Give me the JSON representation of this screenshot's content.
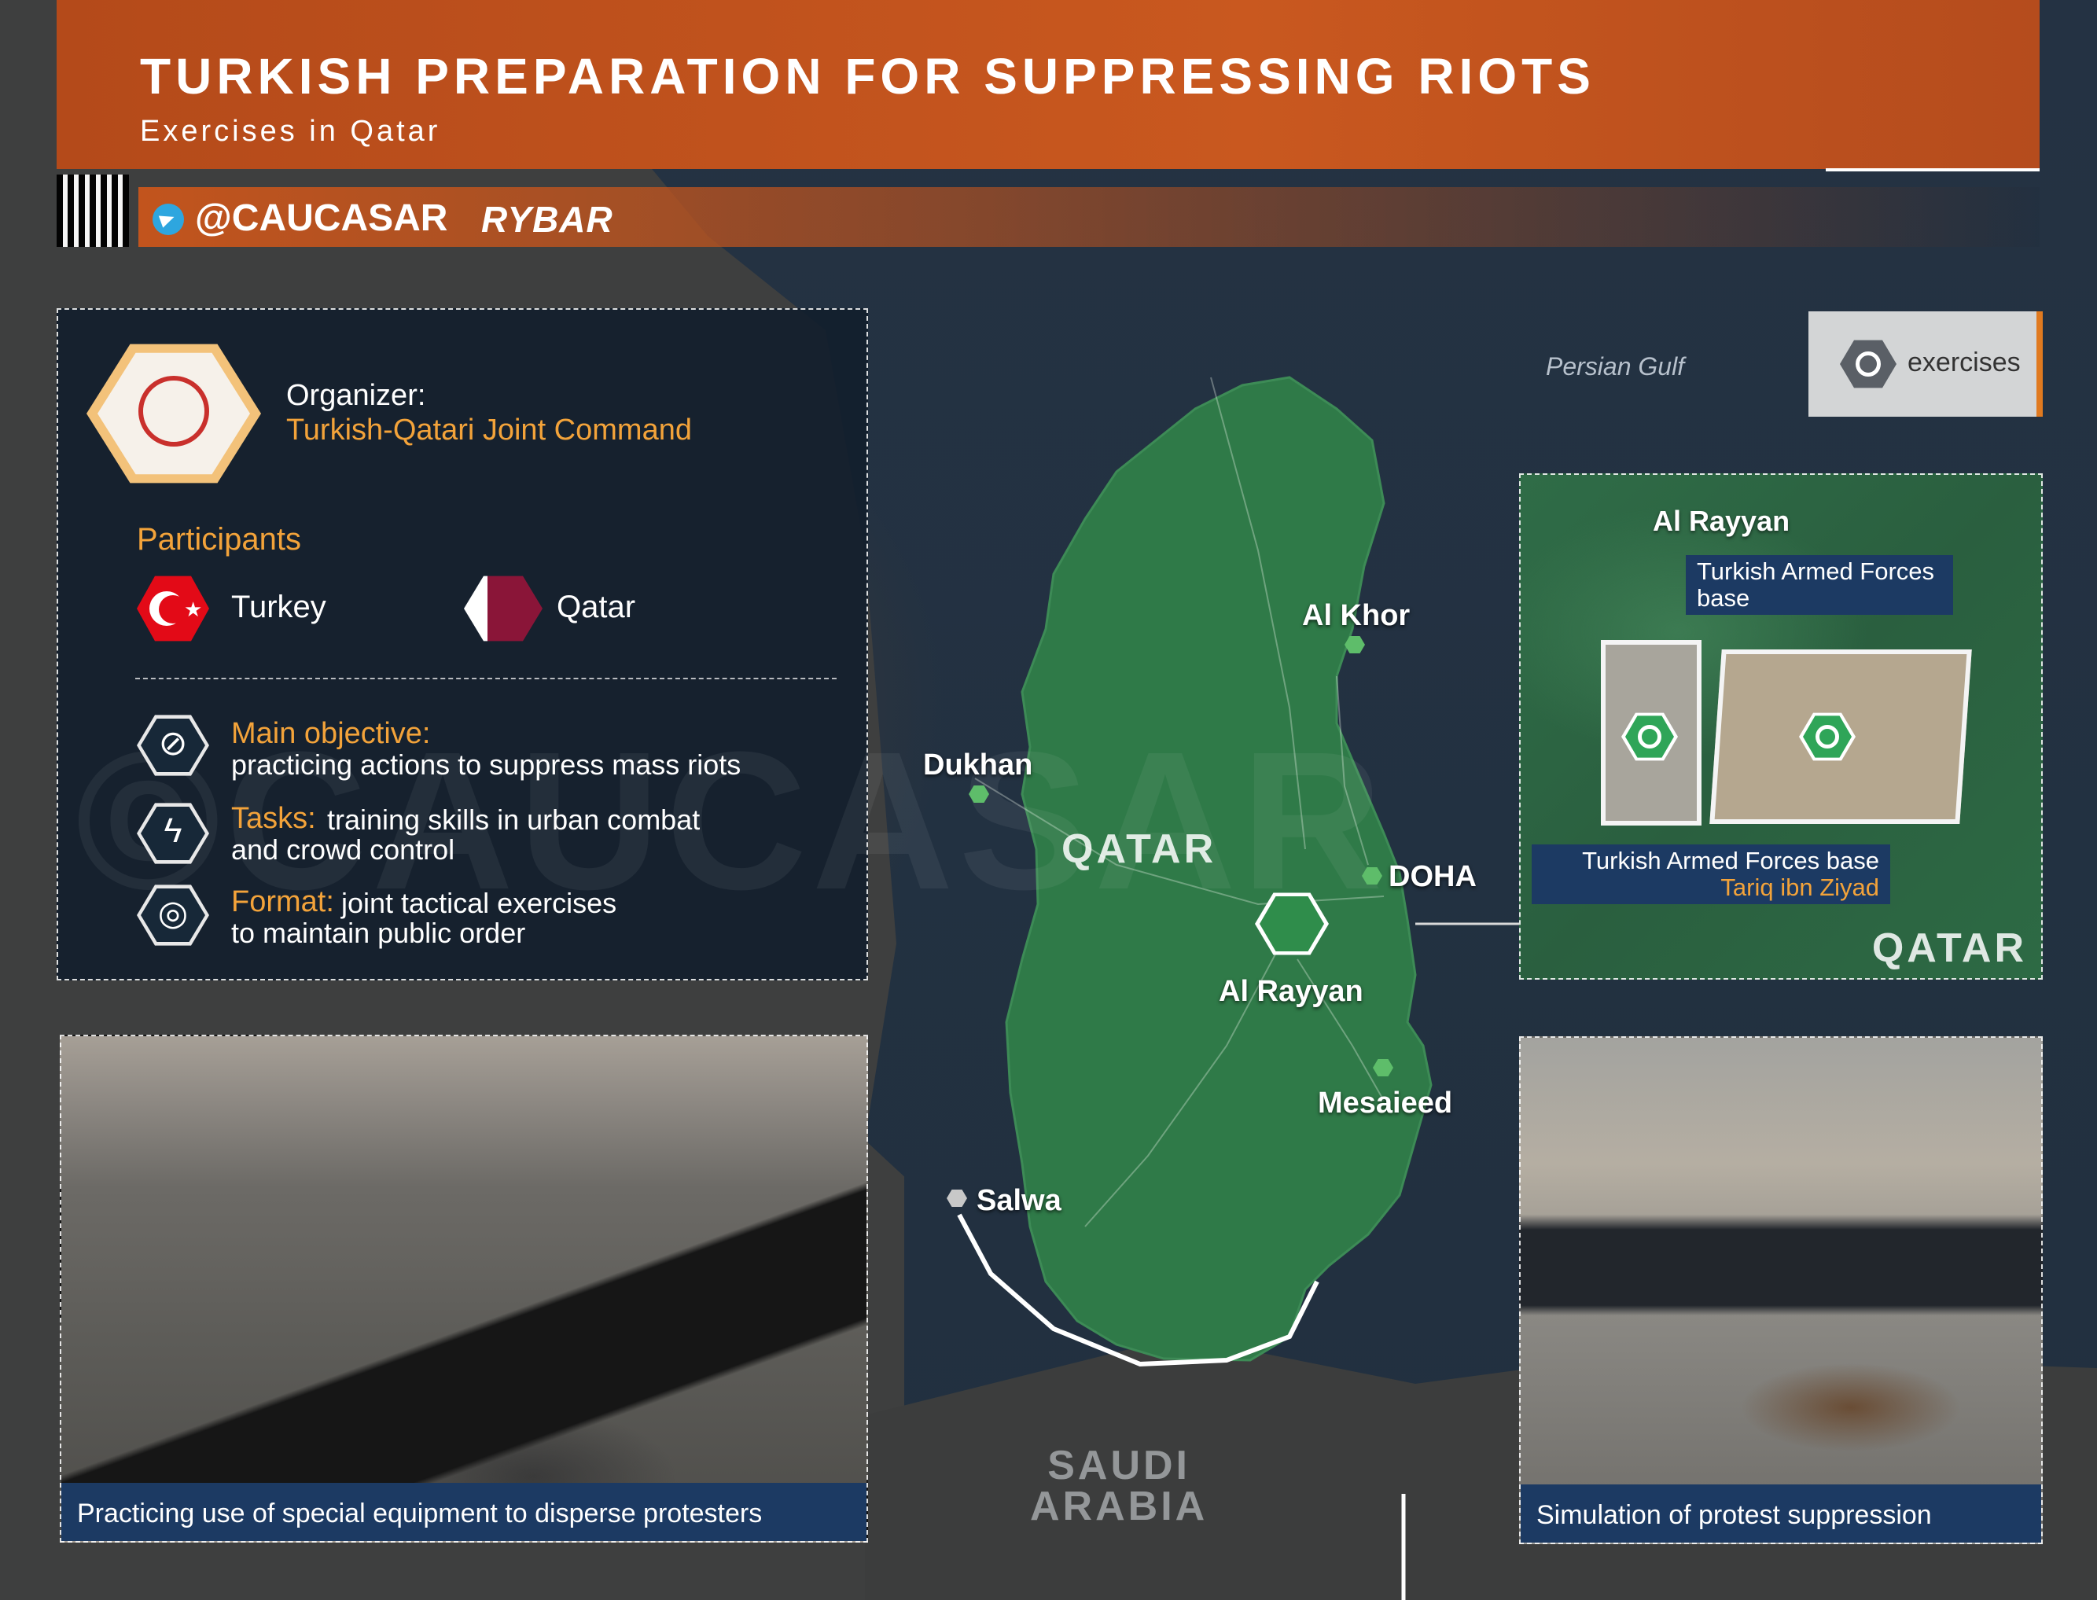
{
  "header": {
    "title": "TURKISH PREPARATION FOR SUPPRESSING RIOTS",
    "subtitle": "Exercises in Qatar",
    "handle": "@CAUCASAR",
    "brand": "RYBAR"
  },
  "info_panel": {
    "organizer_label": "Organizer:",
    "organizer_value": "Turkish-Qatari Joint Command",
    "participants_heading": "Participants",
    "participants": [
      {
        "name": "Turkey",
        "flag_color": "#e30a17"
      },
      {
        "name": "Qatar",
        "flag_color": "#8a1538"
      }
    ],
    "rows": [
      {
        "icon": "no-fist-icon",
        "label": "Main objective:",
        "text_line1": "practicing actions to suppress mass riots",
        "text_line2": ""
      },
      {
        "icon": "lightning-icon",
        "label": "Tasks:",
        "text_line1": "training skills in urban combat",
        "text_line2": "and crowd control"
      },
      {
        "icon": "target-icon",
        "label": "Format:",
        "text_line1": "joint tactical exercises",
        "text_line2": "to maintain public order"
      }
    ],
    "watermark": "©CAUCASAR"
  },
  "legend": {
    "icon": "exercises-target-icon",
    "label": "exercises"
  },
  "map": {
    "sea_label": "Persian Gulf",
    "country_label": "QATAR",
    "neighbor_label_line1": "SAUDI",
    "neighbor_label_line2": "ARABIA",
    "places": [
      {
        "name": "Al Khor"
      },
      {
        "name": "Dukhan"
      },
      {
        "name": "DOHA"
      },
      {
        "name": "Al Rayyan"
      },
      {
        "name": "Mesaieed"
      },
      {
        "name": "Salwa"
      }
    ],
    "land_color": "#2f7a48",
    "water_color": "#21303f"
  },
  "inset": {
    "city_label": "Al Rayyan",
    "base_a_line1": "Turkish Armed Forces",
    "base_a_line2": "base",
    "base_b_line1": "Turkish Armed Forces base",
    "base_b_line2": "Tariq ibn Ziyad",
    "country_label": "QATAR"
  },
  "photos": [
    {
      "caption": "Practicing use of special equipment to disperse protesters"
    },
    {
      "caption": "Simulation of protest suppression"
    }
  ],
  "colors": {
    "accent_orange": "#c9581f",
    "label_orange": "#f3a33a",
    "caption_blue": "#1c3a63",
    "panel_dark": "#121e2c"
  }
}
